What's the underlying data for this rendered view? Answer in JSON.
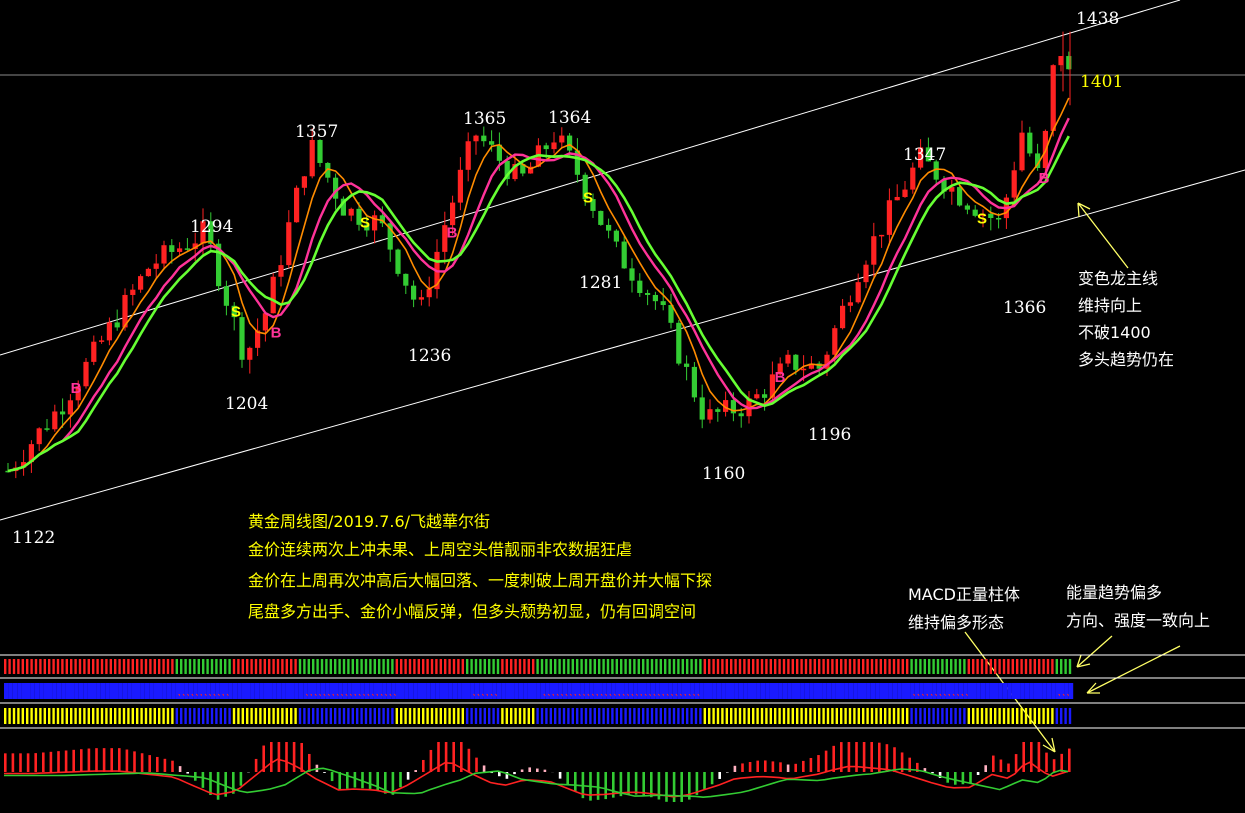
{
  "chart_data": {
    "type": "candlestick",
    "title": "黄金周线图/2019.7.6/飞越華尔街",
    "price_labels": {
      "p1122": "1122",
      "p1204": "1204",
      "p1294": "1294",
      "p1357": "1357",
      "p1236": "1236",
      "p1365": "1365",
      "p1364": "1364",
      "p1281": "1281",
      "p1160": "1160",
      "p1196": "1196",
      "p1347": "1347",
      "p1366": "1366",
      "p1438": "1438",
      "p1401": "1401"
    },
    "current_price": 1401,
    "signals": [
      {
        "label": "B",
        "near_price": 1160
      },
      {
        "label": "S",
        "near_price": 1204
      },
      {
        "label": "B",
        "near_price": 1204
      },
      {
        "label": "S",
        "near_price": 1294
      },
      {
        "label": "B",
        "near_price": 1357
      },
      {
        "label": "S",
        "near_price": 1364
      },
      {
        "label": "B",
        "near_price": 1196
      },
      {
        "label": "S",
        "near_price": 1347
      },
      {
        "label": "B",
        "near_price": 1366
      }
    ],
    "series": [
      {
        "name": "",
        "color": "#66ff33",
        "role": "dragon-main-line"
      },
      {
        "name": "",
        "color": "#ff3399",
        "role": "moving-average"
      },
      {
        "name": "",
        "color": "#ff8c00",
        "role": "moving-average"
      }
    ],
    "indicator_rows": [
      "trend-bars",
      "arrow-strip",
      "energy-bars",
      "macd"
    ],
    "colors": {
      "up": "#ff2222",
      "down": "#33cc33",
      "macd_pos": "#ff2222",
      "macd_neg": "#33cc33",
      "diff": "#ff2222",
      "dea": "#33cc33"
    }
  },
  "notes": {
    "summary": [
      "黄金周线图/2019.7.6/飞越華尔街",
      "金价连续两次上冲未果、上周空头借靓丽非农数据狂虐",
      "金价在上周再次冲高后大幅回落、一度刺破上周开盘价并大幅下探",
      "尾盘多方出手、金价小幅反弹，但多头颓势初显，仍有回调空间"
    ],
    "dragon": [
      "变色龙主线",
      "维持向上",
      "不破1400",
      "多头趋势仍在"
    ],
    "macd": [
      "MACD正量柱体",
      "维持偏多形态"
    ],
    "energy": [
      "能量趋势偏多",
      "方向、强度一致向上"
    ]
  }
}
